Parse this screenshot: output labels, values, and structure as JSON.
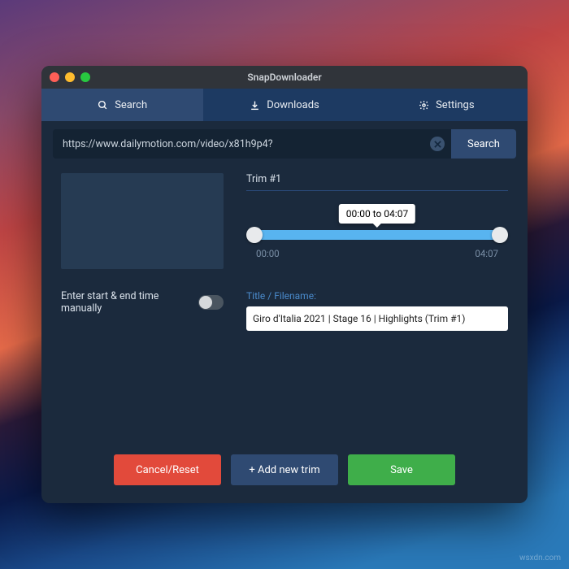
{
  "app": {
    "title": "SnapDownloader"
  },
  "tabs": {
    "search": "Search",
    "downloads": "Downloads",
    "settings": "Settings"
  },
  "url": {
    "value": "https://www.dailymotion.com/video/x81h9p4?",
    "search_label": "Search"
  },
  "trim": {
    "label": "Trim #1",
    "tooltip_start": "00:00",
    "tooltip_sep": " to ",
    "tooltip_end": "04:07",
    "start_time": "00:00",
    "end_time": "04:07"
  },
  "manual": {
    "label": "Enter start & end time manually"
  },
  "filename": {
    "label": "Title / Filename:",
    "value": "Giro d'Italia 2021 | Stage 16 | Highlights (Trim #1)"
  },
  "buttons": {
    "cancel": "Cancel/Reset",
    "add": "+ Add new trim",
    "save": "Save"
  },
  "watermark": "wsxdn.com"
}
